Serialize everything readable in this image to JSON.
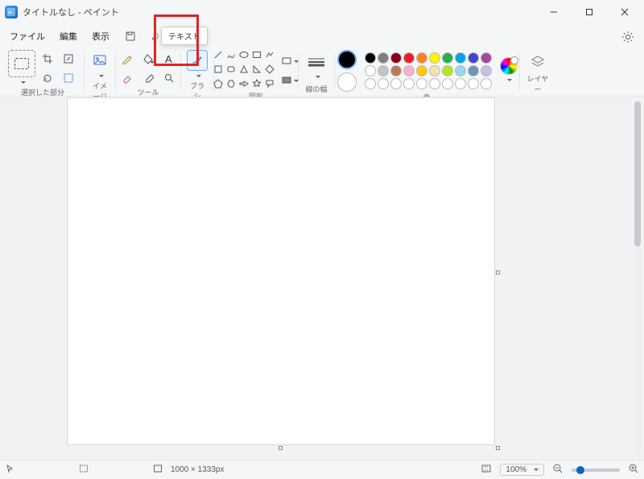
{
  "title": "タイトルなし - ペイント",
  "window_controls": {
    "min": "minimize",
    "max": "maximize",
    "close": "close"
  },
  "menu": {
    "file": "ファイル",
    "edit": "編集",
    "view": "表示"
  },
  "groups": {
    "selection": "選択した部分",
    "image": "イメージ",
    "tools": "ツール",
    "brushes": "ブラシ",
    "shapes": "図形",
    "linewidth": "線の幅",
    "color": "色",
    "layers": "レイヤー"
  },
  "tooltip_text": "テキスト",
  "palette_row1": [
    "#000000",
    "#7f7f7f",
    "#880015",
    "#ed1c24",
    "#ff7f27",
    "#fff200",
    "#22b14c",
    "#00a2e8",
    "#3f48cc",
    "#a349a4"
  ],
  "palette_row2": [
    "#ffffff",
    "#c3c3c3",
    "#b97a57",
    "#ffaec9",
    "#ffc90e",
    "#efe4b0",
    "#b5e61d",
    "#99d9ea",
    "#7092be",
    "#c8bfe7"
  ],
  "palette_row3": [
    "#ffffff",
    "#ffffff",
    "#ffffff",
    "#ffffff",
    "#ffffff",
    "#ffffff",
    "#ffffff",
    "#ffffff",
    "#ffffff",
    "#ffffff"
  ],
  "status": {
    "cursor_icon": "cursor",
    "selection_icon": "selection",
    "size_icon": "canvas-size",
    "size_text": "1000 × 1333px",
    "fit_icon": "fit-to-window",
    "zoom": "100%",
    "zoom_out": "−",
    "zoom_in": "＋"
  }
}
